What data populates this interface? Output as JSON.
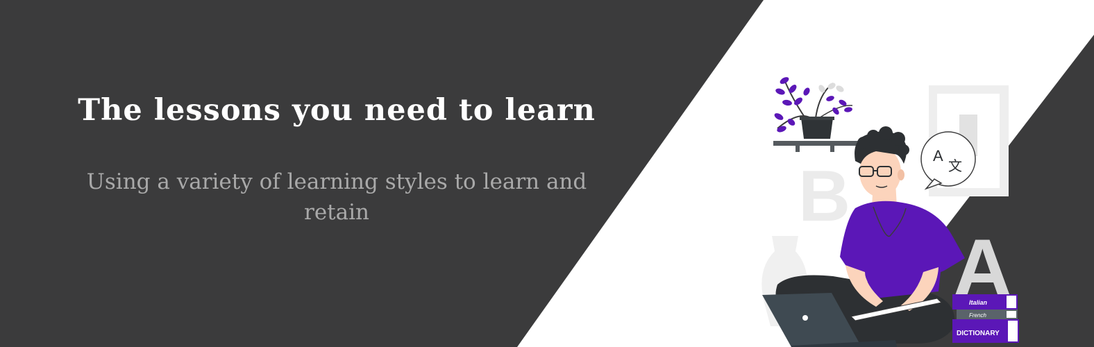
{
  "hero": {
    "headline": "The lessons you need to learn",
    "subtext": "Using a variety of learning styles to learn and retain"
  },
  "illustration": {
    "large_letters": [
      "B",
      "A"
    ],
    "translate_bubble": {
      "latin": "A",
      "cjk": "文"
    },
    "books": [
      "Italian",
      "French",
      "DICTIONARY"
    ]
  },
  "colors": {
    "dark_panel": "#3b3b3c",
    "background": "#ffffff",
    "headline": "#ffffff",
    "subtext": "#a9a9a9",
    "accent_purple": "#5b17b7",
    "laptop": "#3f4a52",
    "pants": "#2d3033"
  }
}
